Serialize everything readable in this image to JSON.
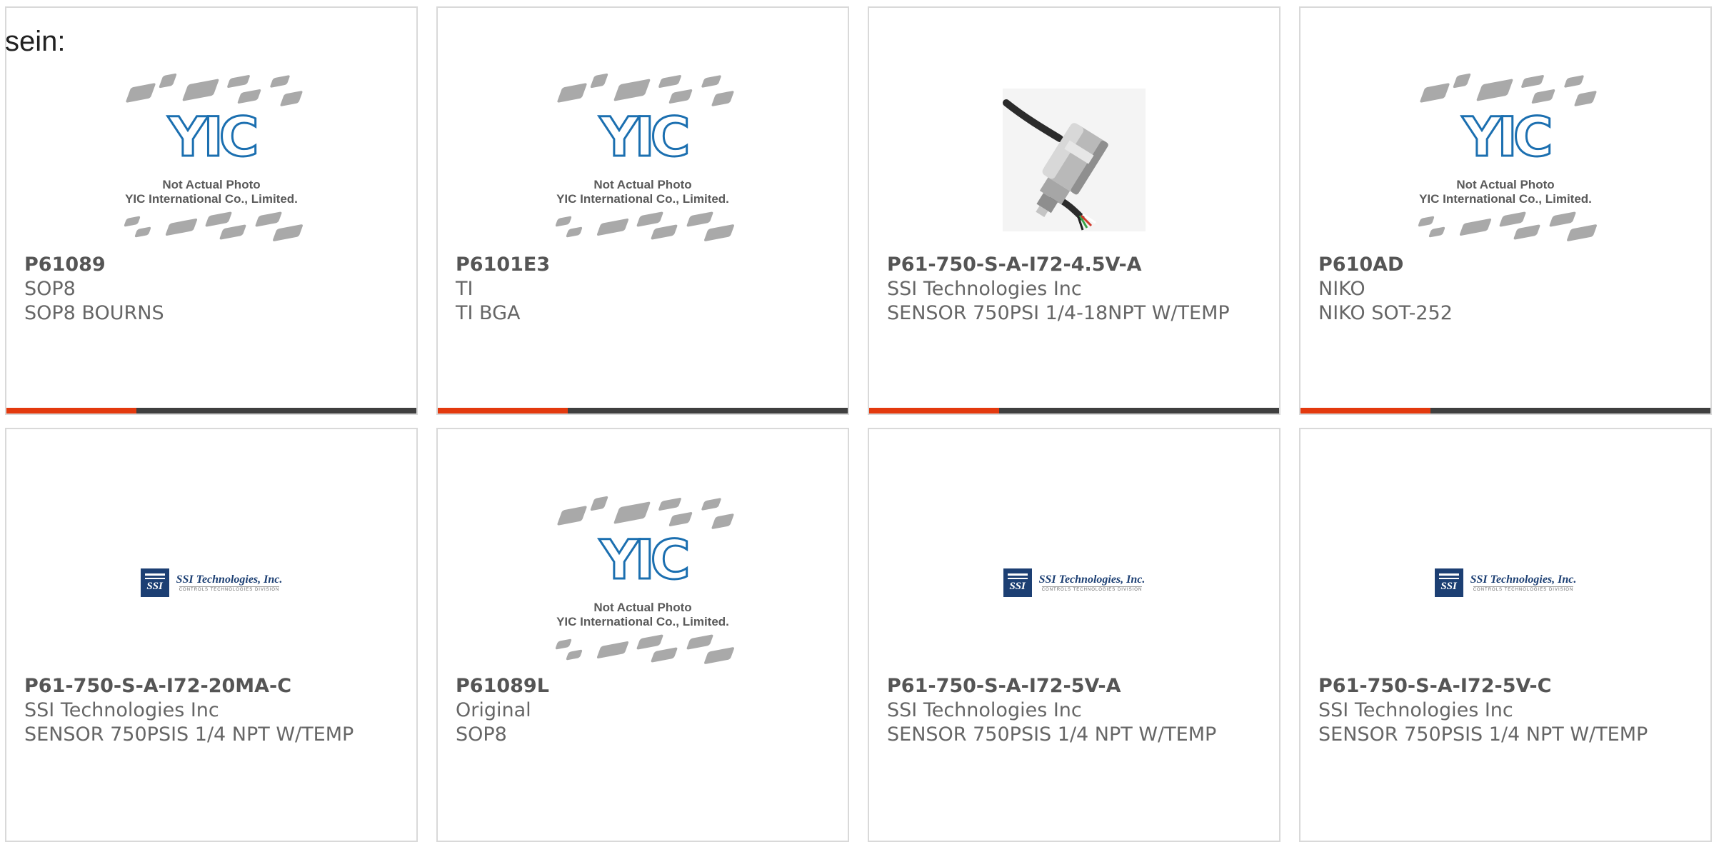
{
  "intro_text": "sein:",
  "placeholder": {
    "logo": "YIC",
    "line1": "Not Actual Photo",
    "line2": "YIC International Co., Limited."
  },
  "ssi_logo": {
    "name": "SSI Technologies, Inc.",
    "mark": "SSI",
    "division": "CONTROLS TECHNOLOGIES DIVISION"
  },
  "colors": {
    "accent": "#e3390e",
    "bar": "#3f3f3f",
    "border": "#d9d9d9",
    "text": "#666666"
  },
  "products": [
    {
      "part": "P61089",
      "mfr": "SOP8",
      "desc": "SOP8 BOURNS",
      "image": "yic-placeholder"
    },
    {
      "part": "P6101E3",
      "mfr": "TI",
      "desc": "TI BGA",
      "image": "yic-placeholder"
    },
    {
      "part": "P61-750-S-A-I72-4.5V-A",
      "mfr": "SSI Technologies Inc",
      "desc": "SENSOR 750PSI 1/4-18NPT W/TEMP",
      "image": "sensor-photo"
    },
    {
      "part": "P610AD",
      "mfr": "NIKO",
      "desc": "NIKO SOT-252",
      "image": "yic-placeholder"
    },
    {
      "part": "P61-750-S-A-I72-20MA-C",
      "mfr": "SSI Technologies Inc",
      "desc": "SENSOR 750PSIS 1/4 NPT W/TEMP",
      "image": "ssi-logo"
    },
    {
      "part": "P61089L",
      "mfr": "Original",
      "desc": "SOP8",
      "image": "yic-placeholder"
    },
    {
      "part": "P61-750-S-A-I72-5V-A",
      "mfr": "SSI Technologies Inc",
      "desc": "SENSOR 750PSIS 1/4 NPT W/TEMP",
      "image": "ssi-logo"
    },
    {
      "part": "P61-750-S-A-I72-5V-C",
      "mfr": "SSI Technologies Inc",
      "desc": "SENSOR 750PSIS 1/4 NPT W/TEMP",
      "image": "ssi-logo"
    }
  ]
}
